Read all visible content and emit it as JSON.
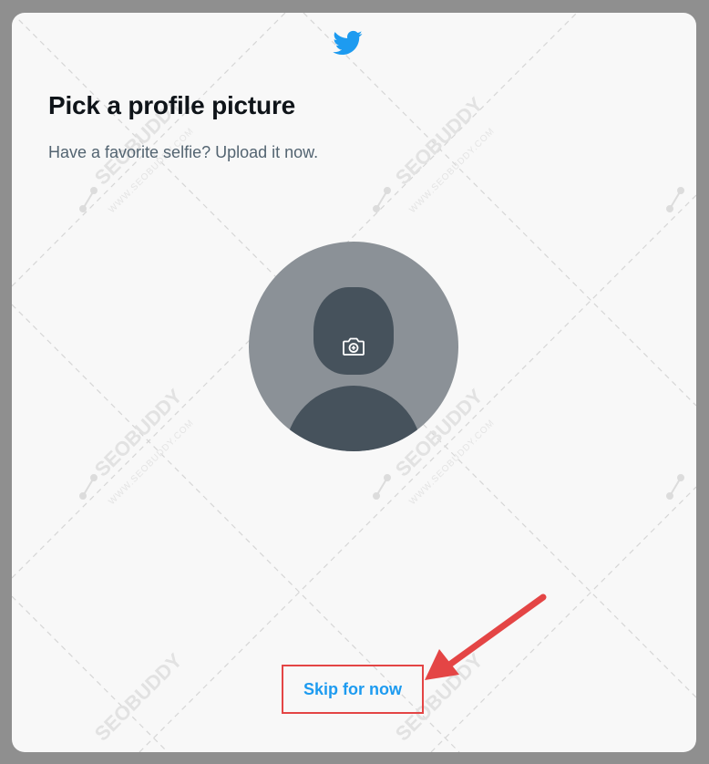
{
  "dialog": {
    "logo_icon": "twitter-bird-icon",
    "title": "Pick a profile picture",
    "subtitle": "Have a favorite selfie? Upload it now.",
    "avatar_icon": "camera-plus-icon",
    "skip_label": "Skip for now"
  },
  "colors": {
    "brand": "#1d9bf0",
    "annotation": "#e44545",
    "avatar_bg": "#8b9197",
    "avatar_silhouette": "#46525c"
  },
  "watermark": {
    "brand": "SEOBUDDY",
    "url": "WWW.SEOBUDDY.COM"
  }
}
